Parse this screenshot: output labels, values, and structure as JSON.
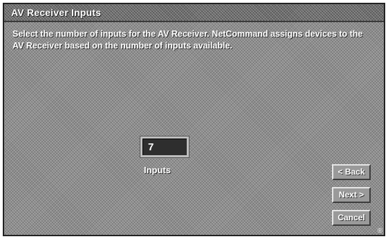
{
  "window": {
    "title": "AV Receiver Inputs"
  },
  "main": {
    "instructions": "Select the number of inputs for the AV Receiver.  NetCommand assigns devices to the AV Receiver based on the number of inputs available.",
    "inputs_value": "7",
    "inputs_label": "Inputs"
  },
  "buttons": {
    "back_label": "< Back",
    "next_label": "Next >",
    "cancel_label": "Cancel"
  },
  "icons": {
    "corner_mark": "®"
  },
  "colors": {
    "panel_gray": "#8e8e8e",
    "title_gray": "#6e6e6e",
    "field_dark": "#2e2e2e",
    "text": "#ffffff"
  }
}
